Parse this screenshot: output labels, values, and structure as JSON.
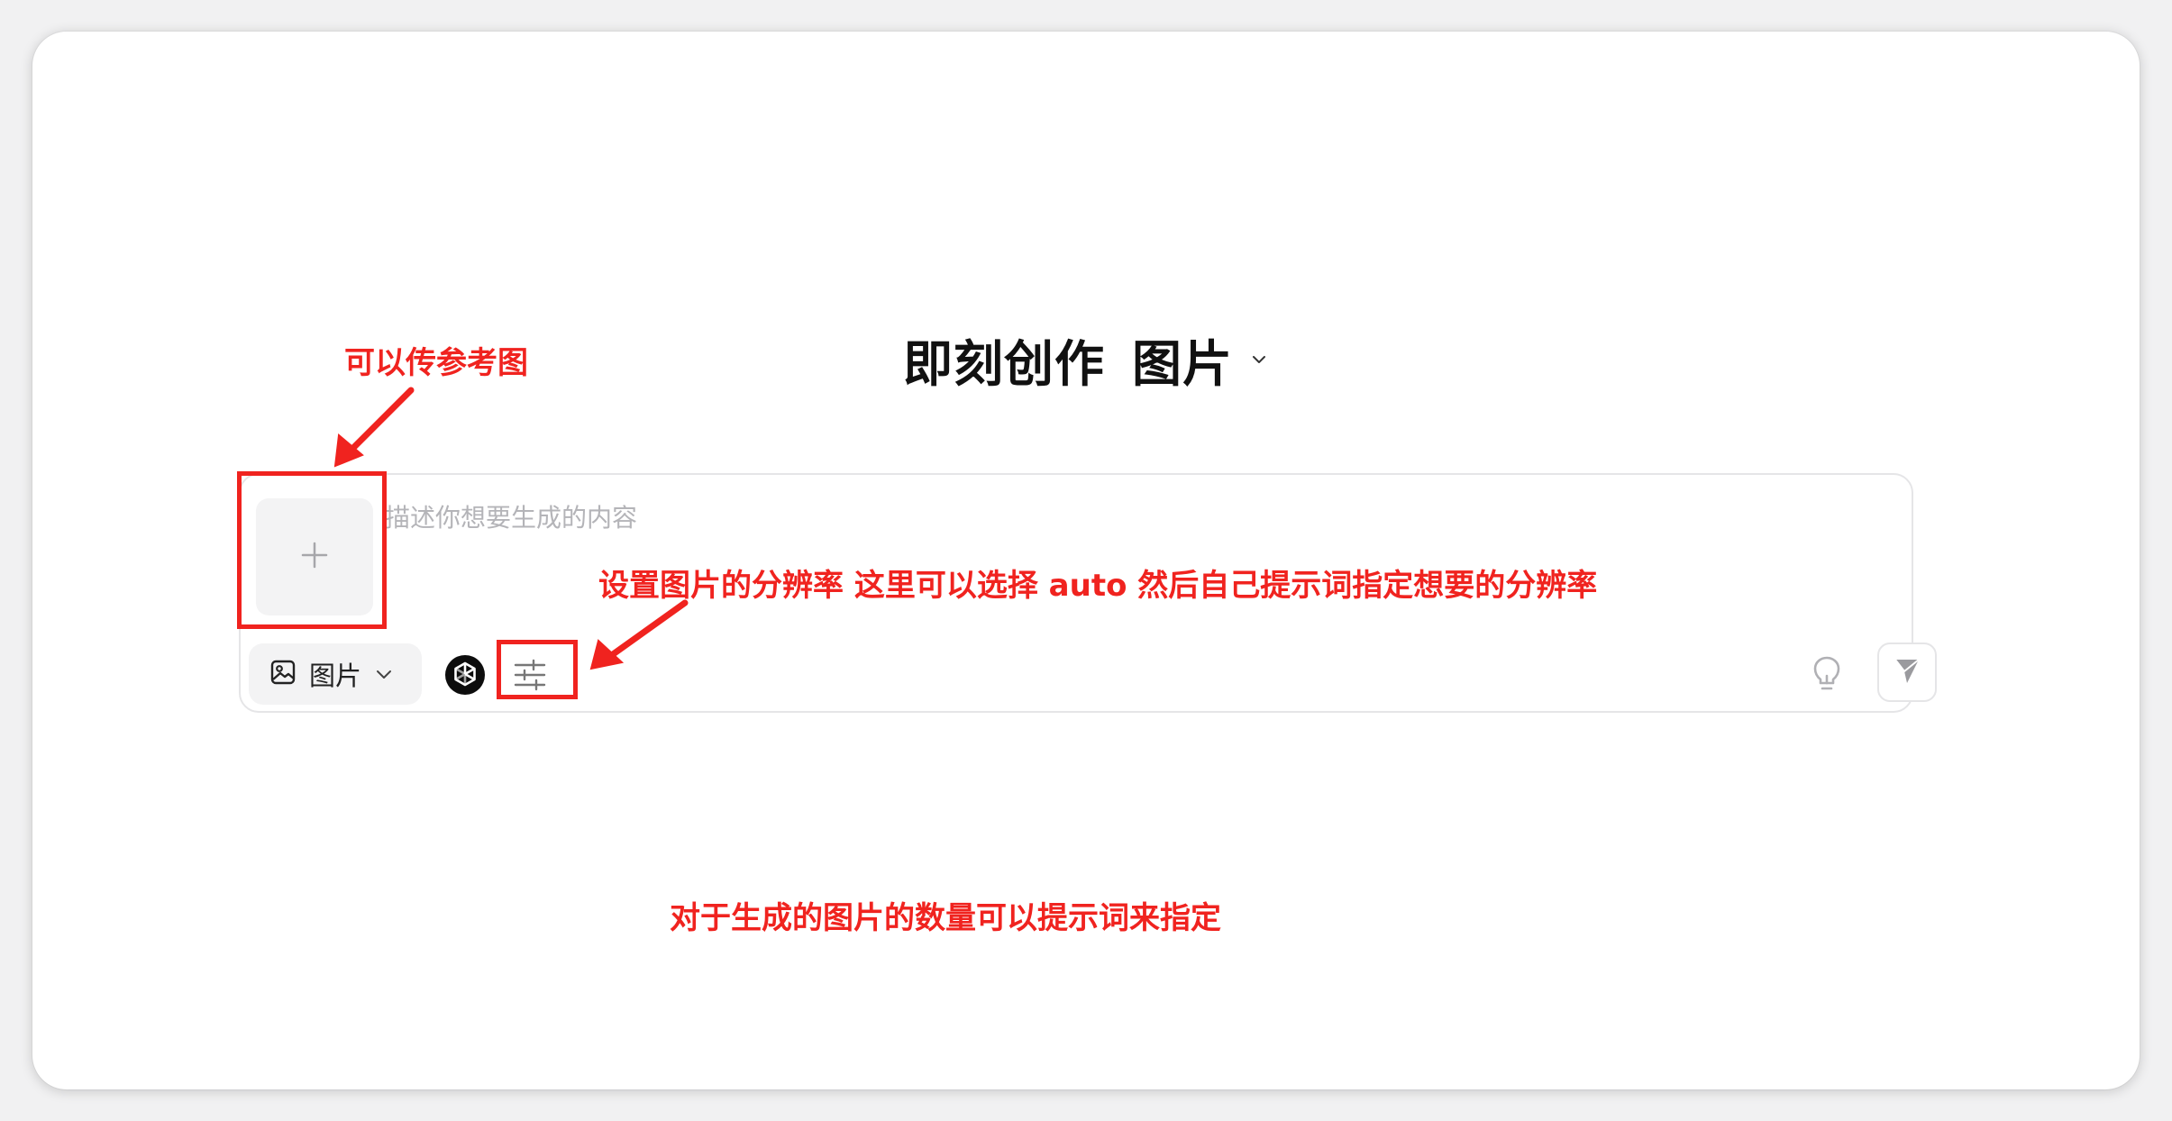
{
  "header": {
    "title": "即刻创作",
    "mode": "图片"
  },
  "composer": {
    "placeholder": "描述你想要生成的内容",
    "upload_icon": "plus-icon",
    "mode_select": {
      "icon": "image-icon",
      "label": "图片"
    },
    "model_icon": "openai-icon",
    "settings_icon": "sliders-icon",
    "hint_icon": "lightbulb-icon",
    "send_icon": "send-icon"
  },
  "annotations": {
    "reference_image": "可以传参考图",
    "resolution": "设置图片的分辨率 这里可以选择 auto 然后自己提示词指定想要的分辨率",
    "quantity": "对于生成的图片的数量可以提示词来指定",
    "color": "#f0231f"
  }
}
